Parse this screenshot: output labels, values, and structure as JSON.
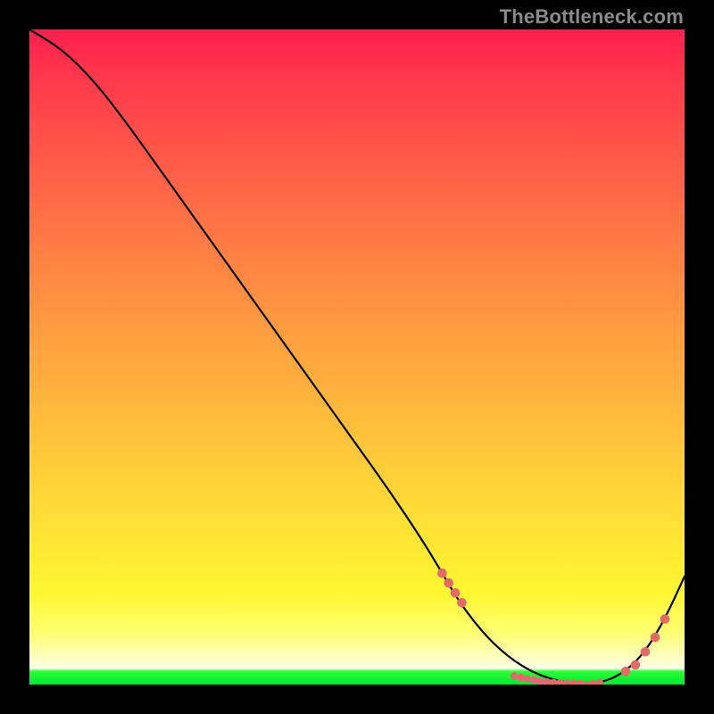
{
  "watermark": "TheBottleneck.com",
  "chart_data": {
    "type": "line",
    "title": "",
    "xlabel": "",
    "ylabel": "",
    "x": [
      0,
      5,
      10,
      15,
      20,
      25,
      30,
      35,
      40,
      45,
      50,
      55,
      60,
      63,
      66,
      70,
      74,
      78,
      82,
      85,
      88,
      91,
      94,
      97,
      100
    ],
    "values": [
      100,
      97,
      92,
      85.5,
      78.5,
      71.5,
      64.5,
      57.5,
      50.5,
      43.5,
      36.5,
      29.5,
      22,
      17,
      12,
      7,
      3.5,
      1.3,
      0.3,
      0,
      0.5,
      2,
      5,
      10,
      16.5
    ],
    "ylim": [
      0,
      100
    ],
    "xlim": [
      0,
      100
    ],
    "markers": {
      "left_cluster_x": [
        63,
        64,
        65,
        66
      ],
      "left_cluster_y": [
        17,
        15.5,
        14,
        12.5
      ],
      "bottom_cluster_x": [
        74,
        75,
        76,
        77,
        78,
        79,
        80,
        81,
        82,
        83,
        84,
        85,
        86,
        87
      ],
      "bottom_cluster_y": [
        1.3,
        1.1,
        0.9,
        0.7,
        0.5,
        0.4,
        0.3,
        0.25,
        0.2,
        0.15,
        0.1,
        0,
        0.1,
        0.3
      ],
      "right_cluster_x": [
        91,
        92.5,
        94,
        95.5,
        97
      ],
      "right_cluster_y": [
        2,
        3,
        5,
        7.2,
        10
      ]
    },
    "gradient": {
      "top": "#ff1f4f",
      "mid": "#ffe634",
      "lower": "#ffffe8",
      "bottom_band": "#00e828"
    }
  }
}
